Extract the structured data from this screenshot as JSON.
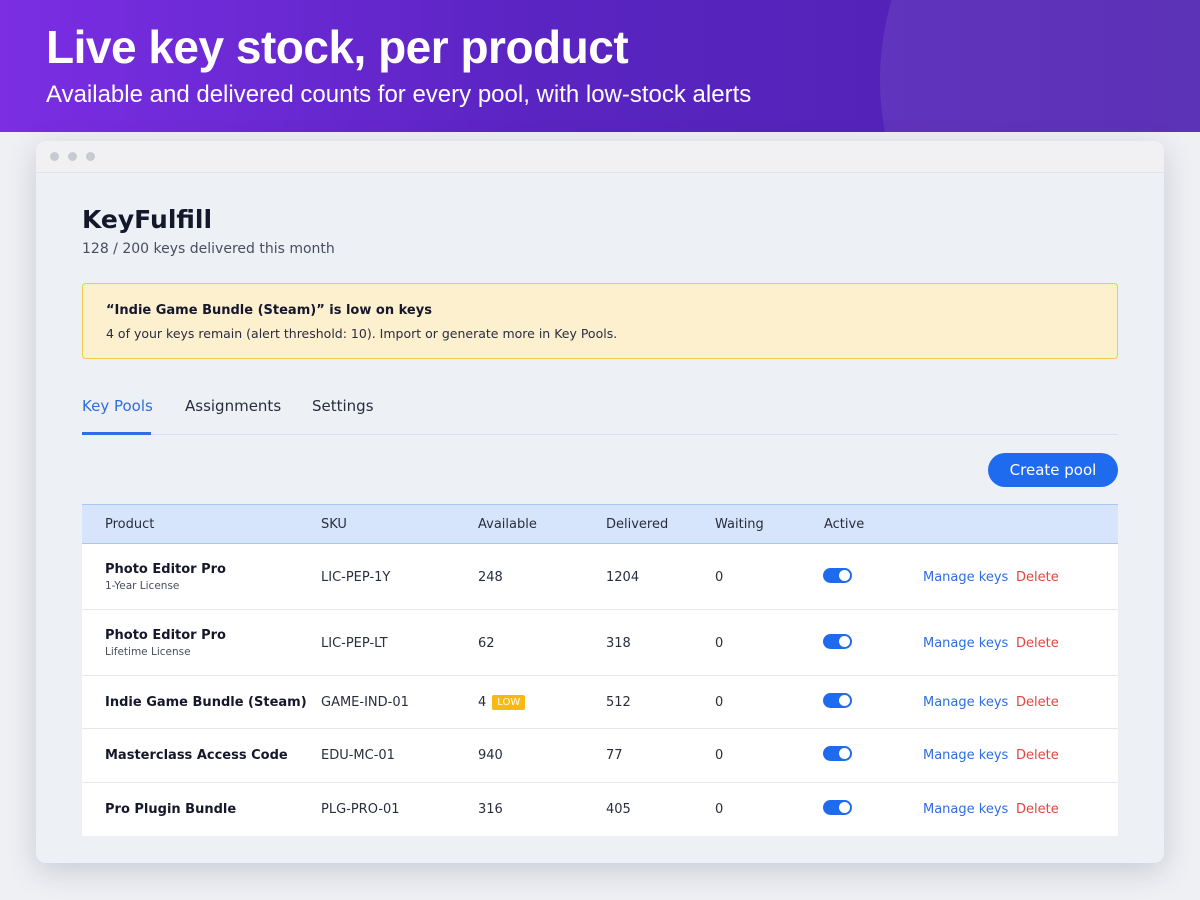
{
  "hero": {
    "title": "Live key stock, per product",
    "subtitle": "Available and delivered counts for every pool, with low-stock alerts"
  },
  "app": {
    "title": "KeyFulfill",
    "usage": "128 / 200 keys delivered this month"
  },
  "alert": {
    "title": "“Indie Game Bundle (Steam)” is low on keys",
    "body": "4 of your keys remain (alert threshold: 10). Import or generate more in Key Pools."
  },
  "tabs": [
    {
      "label": "Key Pools",
      "active": true
    },
    {
      "label": "Assignments",
      "active": false
    },
    {
      "label": "Settings",
      "active": false
    }
  ],
  "actions": {
    "create_pool": "Create pool"
  },
  "table": {
    "columns": [
      "Product",
      "SKU",
      "Available",
      "Delivered",
      "Waiting",
      "Active"
    ],
    "rows": [
      {
        "name": "Photo Editor Pro",
        "sub": "1-Year License",
        "sku": "LIC-PEP-1Y",
        "available": "248",
        "low": "",
        "delivered": "1204",
        "waiting": "0",
        "active": true,
        "manage": "Manage keys",
        "delete": "Delete"
      },
      {
        "name": "Photo Editor Pro",
        "sub": "Lifetime License",
        "sku": "LIC-PEP-LT",
        "available": "62",
        "low": "",
        "delivered": "318",
        "waiting": "0",
        "active": true,
        "manage": "Manage keys",
        "delete": "Delete"
      },
      {
        "name": "Indie Game Bundle (Steam)",
        "sub": "",
        "sku": "GAME-IND-01",
        "available": "4",
        "low": "LOW",
        "delivered": "512",
        "waiting": "0",
        "active": true,
        "manage": "Manage keys",
        "delete": "Delete"
      },
      {
        "name": "Masterclass Access Code",
        "sub": "",
        "sku": "EDU-MC-01",
        "available": "940",
        "low": "",
        "delivered": "77",
        "waiting": "0",
        "active": true,
        "manage": "Manage keys",
        "delete": "Delete"
      },
      {
        "name": "Pro Plugin Bundle",
        "sub": "",
        "sku": "PLG-PRO-01",
        "available": "316",
        "low": "",
        "delivered": "405",
        "waiting": "0",
        "active": true,
        "manage": "Manage keys",
        "delete": "Delete"
      }
    ]
  },
  "colors": {
    "accent": "#1f6bf0",
    "hero_start": "#7b2ee3",
    "hero_end": "#4f21b0",
    "alert_bg": "#fdf0cf",
    "low_badge": "#f9b914",
    "delete": "#e6443f"
  }
}
